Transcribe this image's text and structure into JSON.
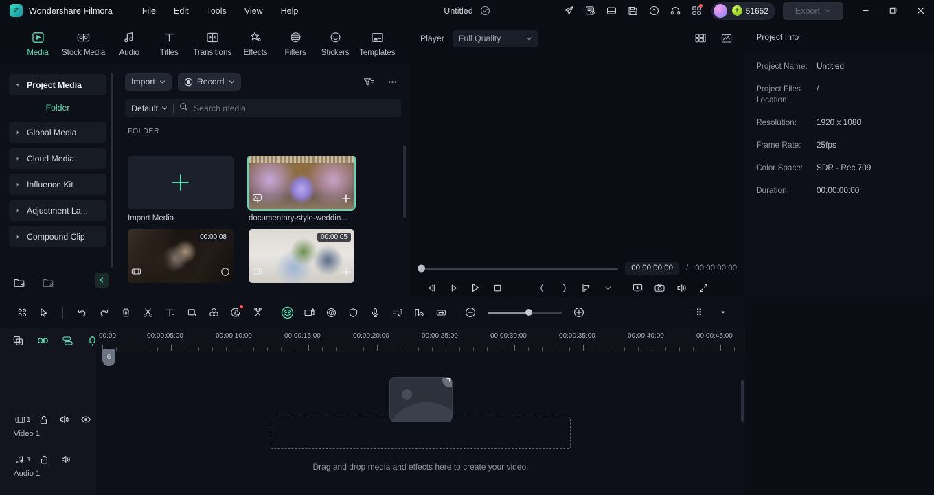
{
  "app": {
    "brand": "Wondershare Filmora",
    "menus": [
      "File",
      "Edit",
      "Tools",
      "View",
      "Help"
    ],
    "doc_title": "Untitled",
    "accent": "#4ee0b4",
    "bg": "#0a0d14"
  },
  "titlebar_right": {
    "icons": [
      "send-icon",
      "script-icon",
      "layout-icon",
      "save-icon",
      "cloud-upload-icon",
      "headset-icon",
      "apps-grid-icon"
    ],
    "credits": "51652",
    "export_label": "Export",
    "window": [
      "minimize",
      "maximize",
      "close"
    ]
  },
  "tabs": [
    {
      "label": "Media",
      "icon": "media-icon",
      "active": true
    },
    {
      "label": "Stock Media",
      "icon": "stock-media-icon",
      "active": false
    },
    {
      "label": "Audio",
      "icon": "audio-icon",
      "active": false
    },
    {
      "label": "Titles",
      "icon": "titles-icon",
      "active": false
    },
    {
      "label": "Transitions",
      "icon": "transitions-icon",
      "active": false
    },
    {
      "label": "Effects",
      "icon": "effects-icon",
      "active": false
    },
    {
      "label": "Filters",
      "icon": "filters-icon",
      "active": false
    },
    {
      "label": "Stickers",
      "icon": "stickers-icon",
      "active": false
    },
    {
      "label": "Templates",
      "icon": "templates-icon",
      "active": false
    }
  ],
  "sidebar": {
    "items": [
      {
        "label": "Project Media",
        "expanded": true,
        "selected": true
      },
      {
        "label": "Global Media",
        "expanded": false,
        "selected": false
      },
      {
        "label": "Cloud Media",
        "expanded": false,
        "selected": false
      },
      {
        "label": "Influence Kit",
        "expanded": false,
        "selected": false
      },
      {
        "label": "Adjustment La...",
        "expanded": false,
        "selected": false
      },
      {
        "label": "Compound Clip",
        "expanded": false,
        "selected": false
      }
    ],
    "sub_item": "Folder",
    "bottom_icons": [
      "new-folder-icon",
      "delete-folder-icon",
      "collapse-panel-icon"
    ]
  },
  "media_panel": {
    "import_label": "Import",
    "record_label": "Record",
    "filter_icon": "filter-sort-icon",
    "more_icon": "more-options-icon",
    "sort_label": "Default",
    "search_placeholder": "Search media",
    "search_value": "",
    "section_label": "FOLDER",
    "items": [
      {
        "name": "Import Media",
        "type": "import-tile",
        "duration": "",
        "selected": false
      },
      {
        "name": "documentary-style-weddin...",
        "type": "image",
        "duration": "",
        "selected": true
      },
      {
        "name": "",
        "type": "video",
        "duration": "00:00:08",
        "selected": false
      },
      {
        "name": "",
        "type": "video",
        "duration": "00:00:05",
        "selected": false
      }
    ]
  },
  "player": {
    "title": "Player",
    "quality": "Full Quality",
    "head_icons": [
      "split-view-icon",
      "scope-icon"
    ],
    "current_time": "00:00:00:00",
    "separator": "/",
    "total_time": "00:00:00:00",
    "transport_icons": [
      "prev-frame-icon",
      "next-frame-icon",
      "play-icon",
      "stop-icon",
      "mark-in-icon",
      "mark-out-icon",
      "add-marker-icon",
      "marker-dropdown-icon",
      "display-icon",
      "snapshot-icon",
      "volume-icon",
      "fullscreen-icon"
    ]
  },
  "project_info": {
    "title": "Project Info",
    "rows": [
      {
        "key": "Project Name:",
        "value": "Untitled"
      },
      {
        "key": "Project Files Location:",
        "value": "/"
      },
      {
        "key": "Resolution:",
        "value": "1920 x 1080"
      },
      {
        "key": "Frame Rate:",
        "value": "25fps"
      },
      {
        "key": "Color Space:",
        "value": "SDR - Rec.709"
      },
      {
        "key": "Duration:",
        "value": "00:00:00:00"
      }
    ]
  },
  "timeline_toolbar": {
    "icons": [
      "grid-view-icon",
      "select-tool-icon",
      "undo-icon",
      "redo-icon",
      "delete-icon",
      "split-icon",
      "text-icon",
      "crop-icon",
      "color-icon",
      "ai-audio-icon",
      "unlink-icon",
      "ai-mask-icon",
      "green-screen-icon",
      "speed-icon",
      "shield-icon",
      "mic-icon",
      "audio-mixer-icon",
      "keyframe-icon",
      "fit-timeline-icon"
    ],
    "zoom_out_icon": "zoom-out-icon",
    "zoom_in_icon": "zoom-in-icon",
    "zoom_value": 56,
    "render_icon": "render-preview-icon",
    "render_dropdown_icon": "chevron-down-icon"
  },
  "timeline": {
    "head_tools": [
      "add-track-icon",
      "link-icon",
      "auto-ripple-icon",
      "magnet-snap-icon"
    ],
    "ruler_ticks": [
      "00:00",
      "00:00:05:00",
      "00:00:10:00",
      "00:00:15:00",
      "00:00:20:00",
      "00:00:25:00",
      "00:00:30:00",
      "00:00:35:00",
      "00:00:40:00",
      "00:00:45:00"
    ],
    "playhead_label": "6",
    "tracks": [
      {
        "label": "Video 1",
        "number": "1",
        "type": "video",
        "icons": [
          "video-track-icon",
          "lock-icon",
          "mute-icon",
          "eye-icon"
        ]
      },
      {
        "label": "Audio 1",
        "number": "1",
        "type": "audio",
        "icons": [
          "audio-track-icon",
          "lock-icon",
          "mute-icon"
        ]
      }
    ],
    "dropzone_text": "Drag and drop media and effects here to create your video.",
    "dropzone_plus": "+"
  }
}
